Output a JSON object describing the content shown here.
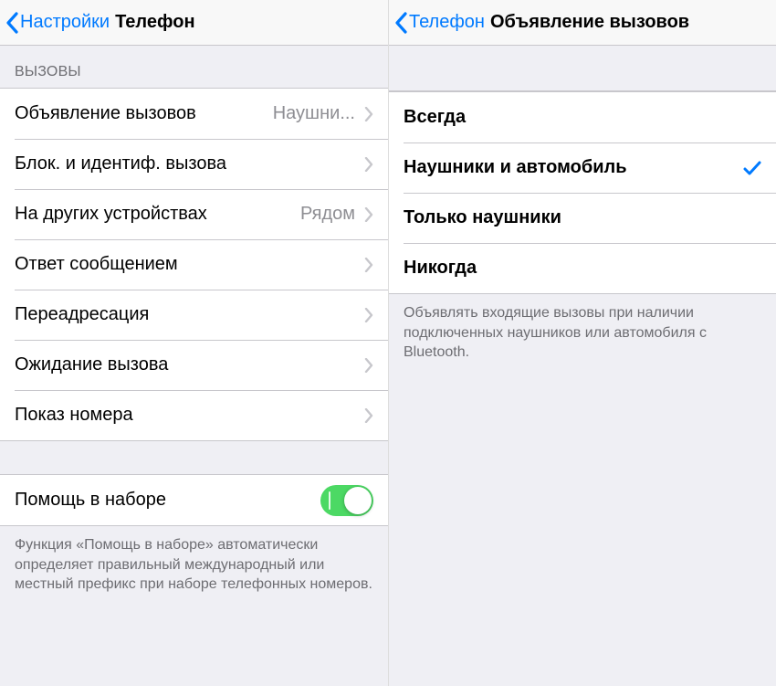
{
  "left": {
    "back": "Настройки",
    "title": "Телефон",
    "section1": "Вызовы",
    "rows": [
      {
        "label": "Объявление вызовов",
        "detail": "Наушни..."
      },
      {
        "label": "Блок. и идентиф. вызова",
        "detail": ""
      },
      {
        "label": "На других устройствах",
        "detail": "Рядом"
      },
      {
        "label": "Ответ сообщением",
        "detail": ""
      },
      {
        "label": "Переадресация",
        "detail": ""
      },
      {
        "label": "Ожидание вызова",
        "detail": ""
      },
      {
        "label": "Показ номера",
        "detail": ""
      }
    ],
    "assist_label": "Помощь в наборе",
    "assist_on": true,
    "footer": "Функция «Помощь в наборе» автоматически определяет правильный международный или местный префикс при наборе телефонных номеров."
  },
  "right": {
    "back": "Телефон",
    "title": "Объявление вызовов",
    "options": [
      {
        "label": "Всегда",
        "selected": false
      },
      {
        "label": "Наушники и автомобиль",
        "selected": true
      },
      {
        "label": "Только наушники",
        "selected": false
      },
      {
        "label": "Никогда",
        "selected": false
      }
    ],
    "footer": "Объявлять входящие вызовы при наличии подключенных наушников или автомобиля с Bluetooth."
  }
}
